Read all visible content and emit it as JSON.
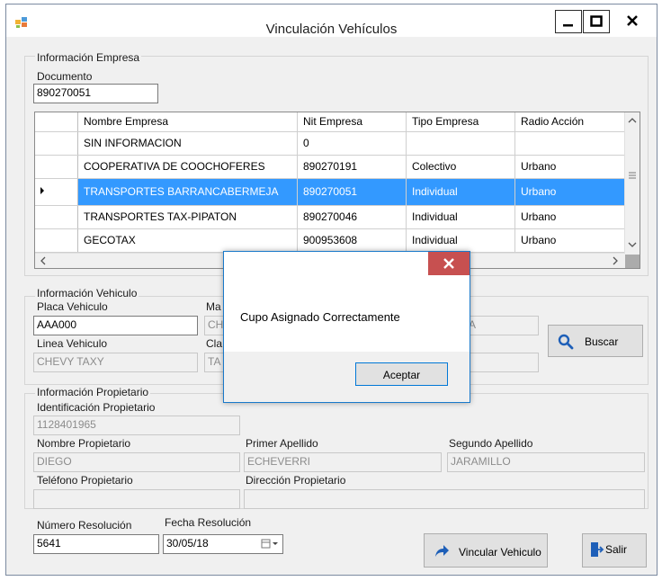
{
  "window": {
    "title": "Vinculación Vehículos",
    "accent": "#3399ff"
  },
  "empresa": {
    "group_title": "Información Empresa",
    "documento_label": "Documento",
    "documento_value": "890270051",
    "grid": {
      "columns": [
        "Nombre Empresa",
        "Nit Empresa",
        "Tipo Empresa",
        "Radio Acción"
      ],
      "rows": [
        [
          "SIN INFORMACION",
          "0",
          "",
          ""
        ],
        [
          "COOPERATIVA DE COOCHOFERES",
          "890270191",
          "Colectivo",
          "Urbano"
        ],
        [
          "TRANSPORTES BARRANCABERMEJA",
          "890270051",
          "Individual",
          "Urbano"
        ],
        [
          "TRANSPORTES TAX-PIPATON",
          "890270046",
          "Individual",
          "Urbano"
        ],
        [
          "GECOTAX",
          "900953608",
          "Individual",
          "Urbano"
        ]
      ],
      "selected_row": 2
    }
  },
  "vehiculo": {
    "group_title": "Información Vehiculo",
    "placa_label": "Placa Vehiculo",
    "placa_value": "AAA000",
    "marca_label_partial": "Ma",
    "marca_value_partial": "CH",
    "linea_label": "Linea Vehiculo",
    "linea_value": "CHEVY TAXY",
    "clase_label_partial": "Cla",
    "clase_value_partial": "TA",
    "sistema_value_partial": "EMA",
    "buscar_label": "Buscar"
  },
  "propietario": {
    "group_title": "Información Propietario",
    "id_label": "Identificación Propietario",
    "id_value": "1128401965",
    "nombre_label": "Nombre Propietario",
    "nombre_value": "DIEGO",
    "primer_apellido_label": "Primer Apellido",
    "primer_apellido_value": "ECHEVERRI",
    "segundo_apellido_label": "Segundo Apellido",
    "segundo_apellido_value": "JARAMILLO",
    "telefono_label": "Teléfono Propietario",
    "telefono_value": "",
    "direccion_label": "Dirección Propietario",
    "direccion_value": ""
  },
  "resolucion": {
    "numero_label": "Número Resolución",
    "numero_value": "5641",
    "fecha_label": "Fecha Resolución",
    "fecha_value": "30/05/18"
  },
  "actions": {
    "vincular_label": "Vincular Vehiculo",
    "salir_label": "Salir"
  },
  "dialog": {
    "message": "Cupo Asignado Correctamente",
    "ok_label": "Aceptar",
    "close_color": "#c75050"
  }
}
